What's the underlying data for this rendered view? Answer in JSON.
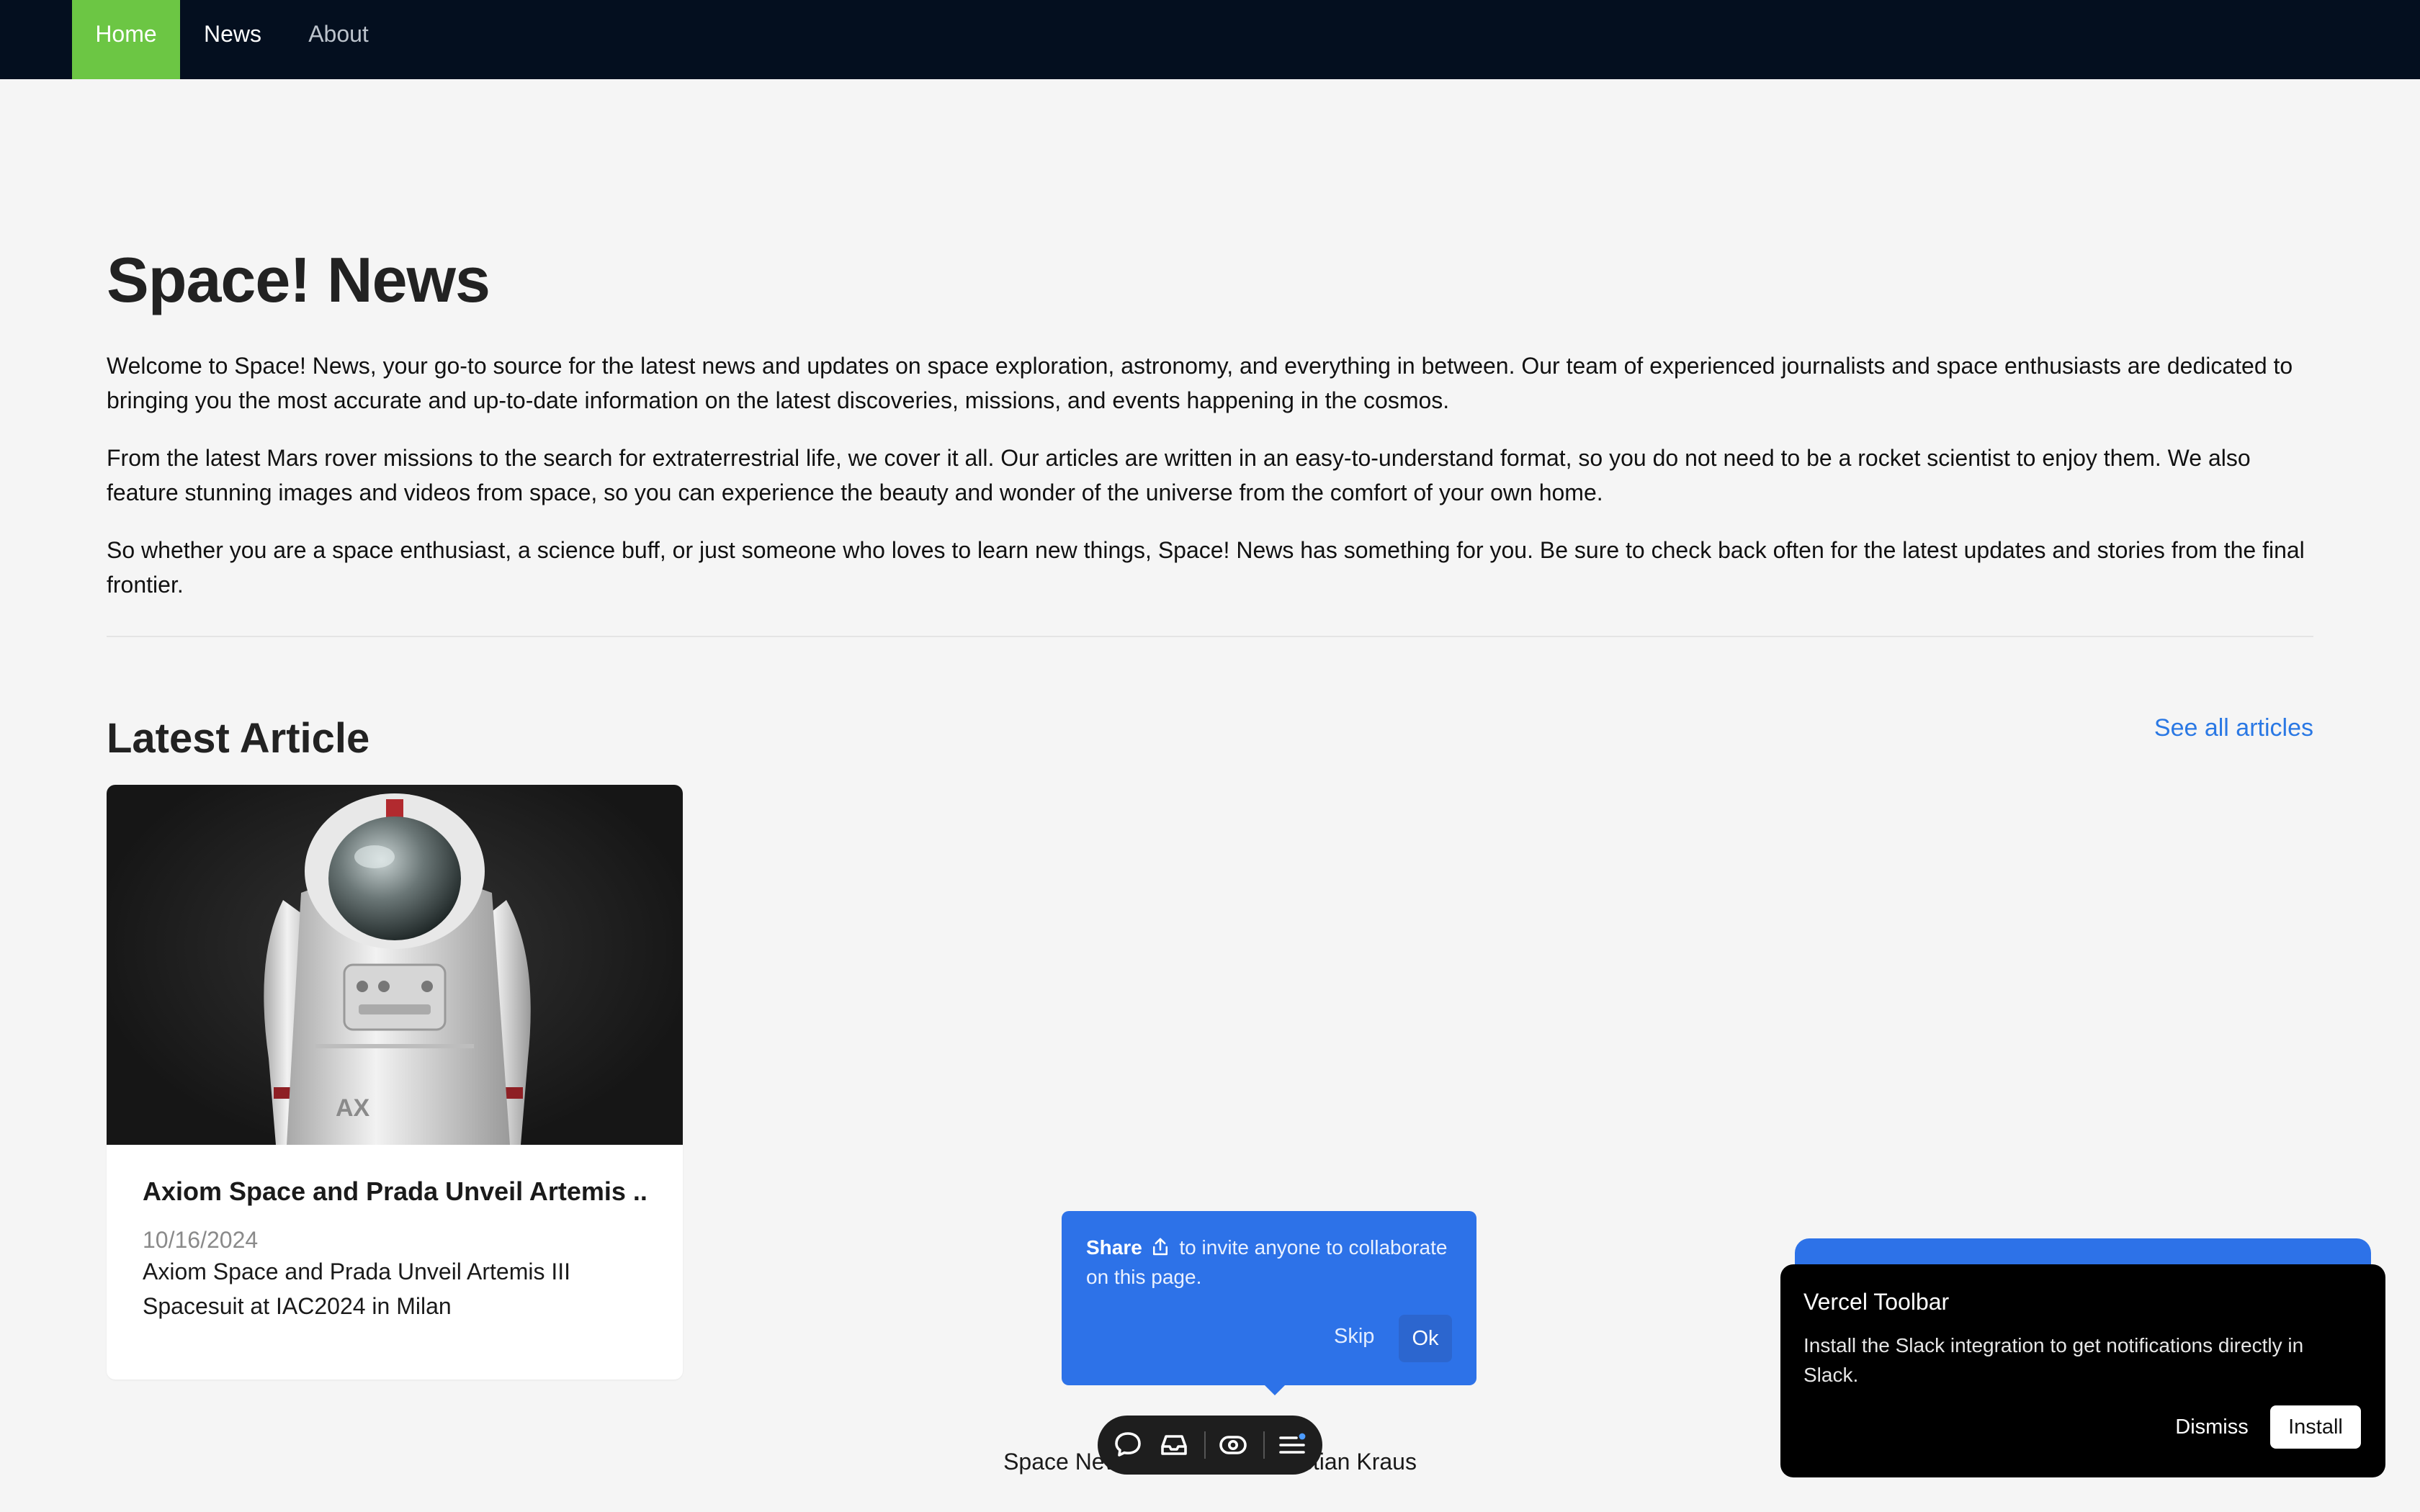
{
  "nav": {
    "items": [
      {
        "label": "Home",
        "active": true
      },
      {
        "label": "News",
        "active": false
      },
      {
        "label": "About",
        "active": false
      }
    ]
  },
  "main": {
    "title": "Space! News",
    "paragraphs": [
      "Welcome to Space! News, your go-to source for the latest news and updates on space exploration, astronomy, and everything in between. Our team of experienced journalists and space enthusiasts are dedicated to bringing you the most accurate and up-to-date information on the latest discoveries, missions, and events happening in the cosmos.",
      "From the latest Mars rover missions to the search for extraterrestrial life, we cover it all. Our articles are written in an easy-to-understand format, so you do not need to be a rocket scientist to enjoy them. We also feature stunning images and videos from space, so you can experience the beauty and wonder of the universe from the comfort of your own home.",
      "So whether you are a space enthusiast, a science buff, or just someone who loves to learn new things, Space! News has something for you. Be sure to check back often for the latest updates and stories from the final frontier."
    ],
    "latest": {
      "heading": "Latest Article",
      "see_all": "See all articles"
    },
    "article": {
      "title": "Axiom Space and Prada Unveil Artemis ...",
      "date": "10/16/2024",
      "description": "Axiom Space and Prada Unveil Artemis III Spacesuit at IAC2024 in Milan",
      "image_label": "AX"
    }
  },
  "footer": {
    "text": "Space News Website by Christian Kraus"
  },
  "share_popover": {
    "strong": "Share",
    "icon": "share-icon",
    "text": "to invite anyone to collaborate on this page.",
    "skip": "Skip",
    "ok": "Ok"
  },
  "toolbar": {
    "icons": [
      "comment-icon",
      "inbox-icon",
      "preview-icon",
      "menu-icon"
    ]
  },
  "vercel": {
    "title": "Vercel Toolbar",
    "body": "Install the Slack integration to get notifications directly in Slack.",
    "dismiss": "Dismiss",
    "install": "Install"
  },
  "colors": {
    "nav_bg": "#040f1f",
    "nav_active": "#6cc644",
    "link": "#2a78e4",
    "popover_blue": "#2d72e8",
    "page_bg": "#f5f5f5"
  }
}
